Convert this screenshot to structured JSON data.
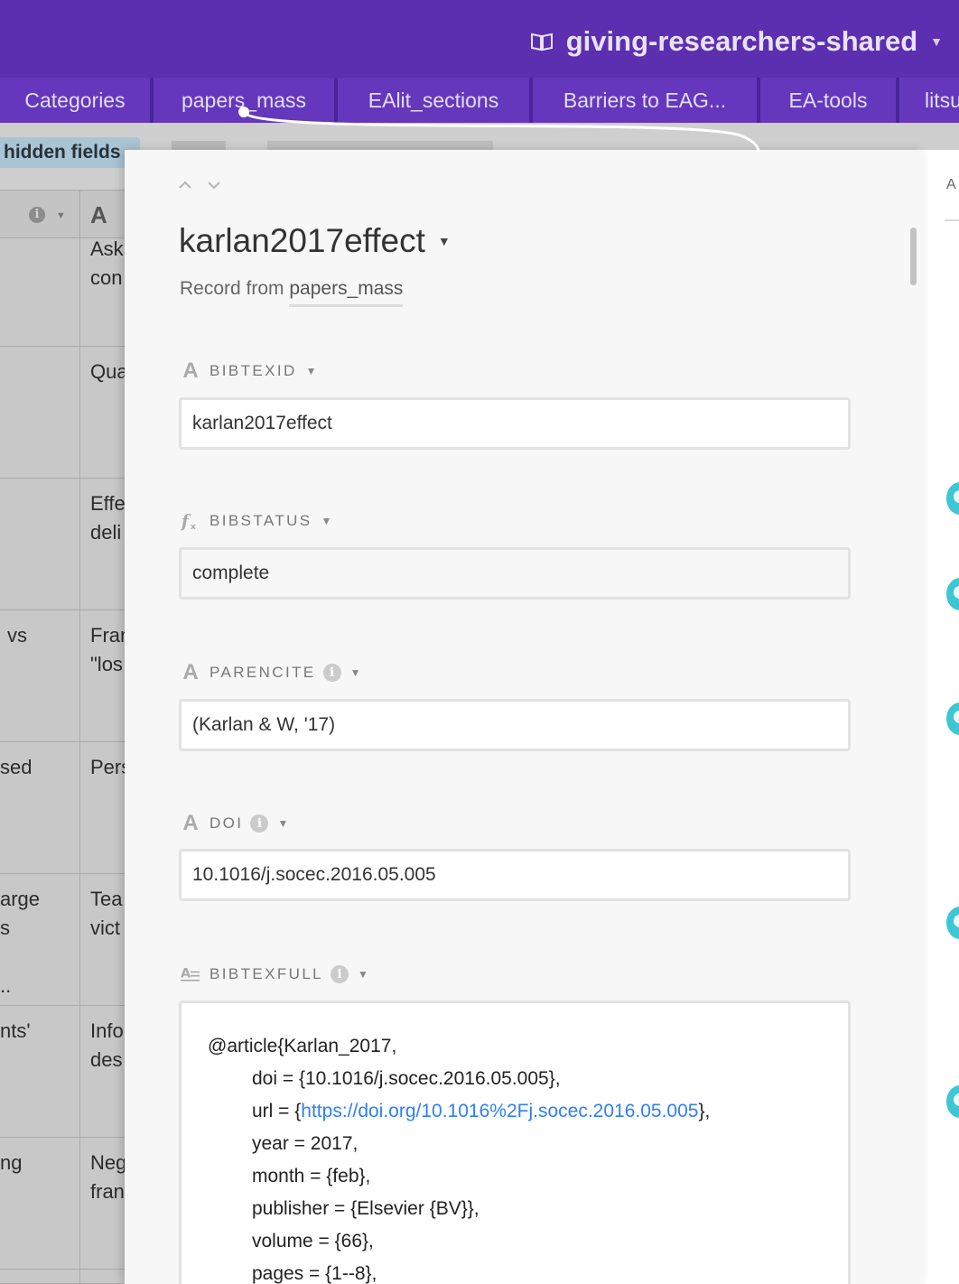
{
  "app": {
    "base_title": "giving-researchers-shared",
    "book_icon": "book-icon",
    "colors": {
      "accent": "#5b2fb0",
      "tab": "#6537bd",
      "link": "#2d7ff9",
      "avatar": "#3fc6d4"
    }
  },
  "tabs": [
    {
      "label": "Categories"
    },
    {
      "label": "papers_mass"
    },
    {
      "label": "EAlit_sections"
    },
    {
      "label": "Barriers to EAG..."
    },
    {
      "label": "EA-tools"
    },
    {
      "label": "litsu"
    }
  ],
  "toolbar": {
    "hidden_fields": "hidden fields"
  },
  "grid": {
    "header_letter": "A",
    "rows": [
      {
        "a": "",
        "b": "Ask\ncon"
      },
      {
        "a": "",
        "b": "Qua"
      },
      {
        "a": "",
        "b": "Effe\ndeli"
      },
      {
        "a": "vs",
        "b": "Fran\n\"los"
      },
      {
        "a": "sed",
        "b": "Pers"
      },
      {
        "a": "arge\ns\n\n..",
        "b": "Tea\nvict"
      },
      {
        "a": "nts'",
        "b": "Info\ndes"
      },
      {
        "a": "ng",
        "b": "Neg\nfran"
      },
      {
        "a": "",
        "b": ""
      }
    ]
  },
  "right_panel": {
    "label": "A"
  },
  "record": {
    "title": "karlan2017effect",
    "subtitle_prefix": "Record from",
    "subtitle_table": "papers_mass",
    "fields": [
      {
        "name": "BIBTEXID",
        "value": "karlan2017effect",
        "icon": "text-icon"
      },
      {
        "name": "BIBSTATUS",
        "value": "complete",
        "icon": "formula-icon"
      },
      {
        "name": "PARENCITE",
        "value": "(Karlan & W, '17)",
        "icon": "text-icon"
      },
      {
        "name": "DOI",
        "value": "10.1016/j.socec.2016.05.005",
        "icon": "text-icon"
      },
      {
        "name": "BIBTEXFULL",
        "icon": "long-text-icon"
      }
    ],
    "bibtexfull": {
      "line1": "@article{Karlan_2017,",
      "doi": "doi = {10.1016/j.socec.2016.05.005},",
      "url_prefix": "url = {",
      "url_link": "https://doi.org/10.1016%2Fj.socec.2016.05.005",
      "url_suffix": "},",
      "year": "year = 2017,",
      "month": "month = {feb},",
      "publisher": "publisher = {Elsevier {BV}},",
      "volume": "volume = {66},",
      "pages": "pages = {1--8},"
    }
  }
}
